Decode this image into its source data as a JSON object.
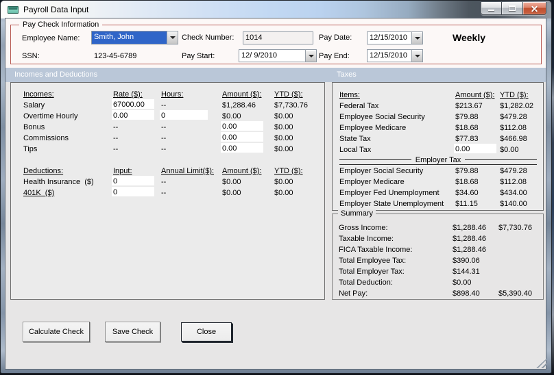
{
  "window": {
    "title": "Payroll Data Input",
    "caption_buttons": {
      "minimize": "minimize",
      "maximize": "maximize",
      "close": "close"
    }
  },
  "pay_check_information": {
    "legend": "Pay Check Information",
    "employee_name_label": "Employee Name:",
    "employee_name_value": "Smith, John",
    "ssn_label": "SSN:",
    "ssn_value": "123-45-6789",
    "check_number_label": "Check Number:",
    "check_number_value": "1014",
    "pay_start_label": "Pay Start:",
    "pay_start_value": "12/ 9/2010",
    "pay_date_label": "Pay Date:",
    "pay_date_value": "12/15/2010",
    "pay_end_label": "Pay End:",
    "pay_end_value": "12/15/2010",
    "frequency": "Weekly"
  },
  "sections": {
    "incomes_and_deductions": "Incomes and Deductions",
    "taxes": "Taxes"
  },
  "incomes": {
    "headers": [
      "Incomes:",
      "Rate ($):",
      "Hours:",
      "Amount ($):",
      "YTD ($):"
    ],
    "rows": [
      {
        "label": "Salary",
        "rate": "67000.00",
        "rate_input": true,
        "hours": "--",
        "hours_input": false,
        "amount": "$1,288.46",
        "amount_input": false,
        "ytd": "$7,730.76"
      },
      {
        "label": "Overtime Hourly",
        "rate": "0.00",
        "rate_input": true,
        "hours": "0",
        "hours_input": true,
        "amount": "$0.00",
        "amount_input": false,
        "ytd": "$0.00"
      },
      {
        "label": "Bonus",
        "rate": "--",
        "rate_input": false,
        "hours": "--",
        "hours_input": false,
        "amount": "0.00",
        "amount_input": true,
        "ytd": "$0.00"
      },
      {
        "label": "Commissions",
        "rate": "--",
        "rate_input": false,
        "hours": "--",
        "hours_input": false,
        "amount": "0.00",
        "amount_input": true,
        "ytd": "$0.00"
      },
      {
        "label": "Tips",
        "rate": "--",
        "rate_input": false,
        "hours": "--",
        "hours_input": false,
        "amount": "0.00",
        "amount_input": true,
        "ytd": "$0.00"
      }
    ]
  },
  "deductions": {
    "headers": [
      "Deductions:",
      "Input:",
      "Annual Limit($):",
      "Amount ($):",
      "YTD ($):"
    ],
    "rows": [
      {
        "label": "Health Insurance  ($)",
        "underline": false,
        "input": "0",
        "limit": "--",
        "amount": "$0.00",
        "ytd": "$0.00"
      },
      {
        "label": "401K  ($)",
        "underline": true,
        "input": "0",
        "limit": "--",
        "amount": "$0.00",
        "ytd": "$0.00"
      }
    ]
  },
  "taxes": {
    "headers": [
      "Items:",
      "Amount ($):",
      "YTD ($):"
    ],
    "employee_rows": [
      {
        "label": "Federal Tax",
        "amount": "$213.67",
        "amount_input": false,
        "ytd": "$1,282.02"
      },
      {
        "label": "Employee Social Security",
        "amount": "$79.88",
        "amount_input": false,
        "ytd": "$479.28"
      },
      {
        "label": "Employee Medicare",
        "amount": "$18.68",
        "amount_input": false,
        "ytd": "$112.08"
      },
      {
        "label": "State Tax",
        "amount": "$77.83",
        "amount_input": false,
        "ytd": "$466.98"
      },
      {
        "label": "Local Tax",
        "amount": "0.00",
        "amount_input": true,
        "ytd": "$0.00"
      }
    ],
    "divider_label": "Employer Tax",
    "employer_rows": [
      {
        "label": "Employer Social Security",
        "amount": "$79.88",
        "ytd": "$479.28"
      },
      {
        "label": "Employer Medicare",
        "amount": "$18.68",
        "ytd": "$112.08"
      },
      {
        "label": "Employer Fed Unemployment",
        "amount": "$34.60",
        "ytd": "$434.00"
      },
      {
        "label": "Employer State Unemployment",
        "amount": "$11.15",
        "ytd": "$140.00"
      }
    ]
  },
  "summary": {
    "legend": "Summary",
    "rows": [
      {
        "label": "Gross Income:",
        "amount": "$1,288.46",
        "ytd": "$7,730.76"
      },
      {
        "label": "Taxable Income:",
        "amount": "$1,288.46",
        "ytd": ""
      },
      {
        "label": "FICA Taxable Income:",
        "amount": "$1,288.46",
        "ytd": ""
      },
      {
        "label": "Total Employee Tax:",
        "amount": "$390.06",
        "ytd": ""
      },
      {
        "label": "Total Employer Tax:",
        "amount": "$144.31",
        "ytd": ""
      },
      {
        "label": "Total Deduction:",
        "amount": "$0.00",
        "ytd": ""
      },
      {
        "label": "Net Pay:",
        "amount": "$898.40",
        "ytd": "$5,390.40"
      }
    ]
  },
  "action_buttons": {
    "calculate": "Calculate Check",
    "save": "Save Check",
    "close": "Close"
  },
  "colors": {
    "titlebar_blue": "#bcd4ee",
    "section_bar_blue": "#bac7d8",
    "groupbox_red": "#b85c55",
    "selection_blue": "#2f65c8",
    "close_button_red": "#c85a3a",
    "window_frame": "#93a2b4",
    "content_gray": "#e7e6e6",
    "paycheck_bg": "#fcf8f7"
  }
}
